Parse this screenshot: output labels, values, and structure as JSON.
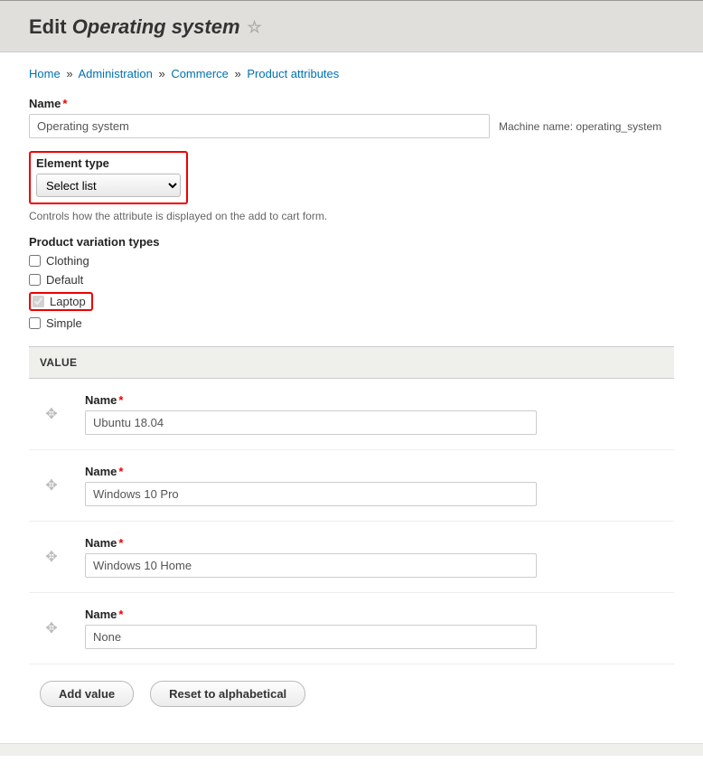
{
  "header": {
    "title_prefix": "Edit",
    "title_em": "Operating system"
  },
  "breadcrumb": {
    "home": "Home",
    "admin": "Administration",
    "commerce": "Commerce",
    "attributes": "Product attributes",
    "sep": "»"
  },
  "form": {
    "name_label": "Name",
    "name_value": "Operating system",
    "machine_name_label": "Machine name:",
    "machine_name_value": "operating_system",
    "element_type_label": "Element type",
    "element_type_value": "Select list",
    "element_type_desc": "Controls how the attribute is displayed on the add to cart form.",
    "variation_label": "Product variation types",
    "variation_types": [
      {
        "label": "Clothing",
        "checked": false,
        "highlight": false
      },
      {
        "label": "Default",
        "checked": false,
        "highlight": false
      },
      {
        "label": "Laptop",
        "checked": true,
        "highlight": true,
        "disabled": true
      },
      {
        "label": "Simple",
        "checked": false,
        "highlight": false
      }
    ]
  },
  "values": {
    "header": "VALUE",
    "row_name_label": "Name",
    "rows": [
      {
        "value": "Ubuntu 18.04"
      },
      {
        "value": "Windows 10 Pro"
      },
      {
        "value": "Windows 10 Home"
      },
      {
        "value": "None"
      }
    ]
  },
  "actions": {
    "add_value": "Add value",
    "reset": "Reset to alphabetical"
  }
}
